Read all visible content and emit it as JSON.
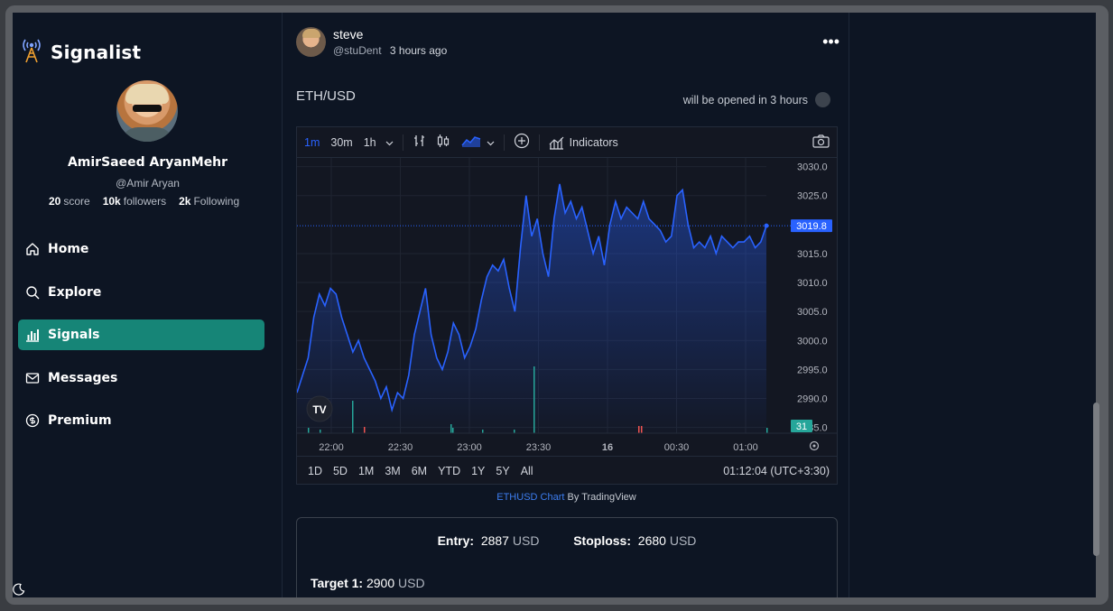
{
  "app": {
    "name": "Signalist"
  },
  "profile": {
    "name": "AmirSaeed AryanMehr",
    "handle": "@Amir Aryan",
    "stats": [
      {
        "value": "20",
        "label": "score"
      },
      {
        "value": "10k",
        "label": "followers"
      },
      {
        "value": "2k",
        "label": "Following"
      }
    ]
  },
  "nav": {
    "items": [
      {
        "label": "Home",
        "icon": "home-icon"
      },
      {
        "label": "Explore",
        "icon": "search-icon"
      },
      {
        "label": "Signals",
        "icon": "bar-chart-icon",
        "active": true
      },
      {
        "label": "Messages",
        "icon": "mail-icon"
      },
      {
        "label": "Premium",
        "icon": "coin-icon"
      }
    ]
  },
  "post": {
    "author": "steve",
    "handle": "@stuDent",
    "time": "3 hours ago",
    "pair": "ETH/USD",
    "open_note": "will be opened in 3 hours"
  },
  "chart_toolbar": {
    "timeframes": [
      "1m",
      "30m",
      "1h"
    ],
    "active_timeframe": "1m",
    "indicators_label": "Indicators"
  },
  "chart_data": {
    "type": "area",
    "x_ticks": [
      "22:00",
      "22:30",
      "23:00",
      "23:30",
      "16",
      "00:30",
      "01:00"
    ],
    "y_ticks": [
      "3030.0",
      "3025.0",
      "3015.0",
      "3010.0",
      "3005.0",
      "3000.0",
      "2995.0",
      "2990.0",
      "2985.0"
    ],
    "ylim": [
      2984,
      3031.5
    ],
    "last_price": "3019.8",
    "volume_badge": "31",
    "values": [
      2991,
      2994,
      2997,
      3004,
      3008,
      3006,
      3009,
      3008,
      3004,
      3001,
      2998,
      3000,
      2997,
      2995,
      2993,
      2990,
      2992,
      2988,
      2991,
      2990,
      2994,
      3001,
      3005,
      3009,
      3001,
      2997,
      2995,
      2998,
      3003,
      3001,
      2997,
      2999,
      3002,
      3007,
      3011,
      3013,
      3012,
      3014,
      3009,
      3005,
      3016,
      3025,
      3018,
      3021,
      3015,
      3011,
      3021,
      3027,
      3022,
      3024,
      3021,
      3023,
      3019,
      3015,
      3018,
      3013,
      3020,
      3024,
      3021,
      3023,
      3022,
      3021,
      3024,
      3021,
      3020,
      3019,
      3017,
      3018,
      3025,
      3026,
      3020,
      3016,
      3017,
      3016,
      3018,
      3015,
      3018,
      3017,
      3016,
      3017,
      3017,
      3018,
      3016,
      3017,
      3019.8
    ],
    "ranges": [
      "1D",
      "5D",
      "1M",
      "3M",
      "6M",
      "YTD",
      "1Y",
      "5Y",
      "All"
    ],
    "clock": "01:12:04 (UTC+3:30)"
  },
  "credit": {
    "link": "ETHUSD Chart",
    "suffix": " By TradingView"
  },
  "signal": {
    "entry_label": "Entry:",
    "entry_value": "2887",
    "stoploss_label": "Stoploss:",
    "stoploss_value": "2680",
    "unit": "USD",
    "target_label": "Target 1:",
    "target_value": "2900"
  },
  "colors": {
    "accent": "#168577",
    "line": "#2962ff",
    "bg": "#0d1523"
  }
}
